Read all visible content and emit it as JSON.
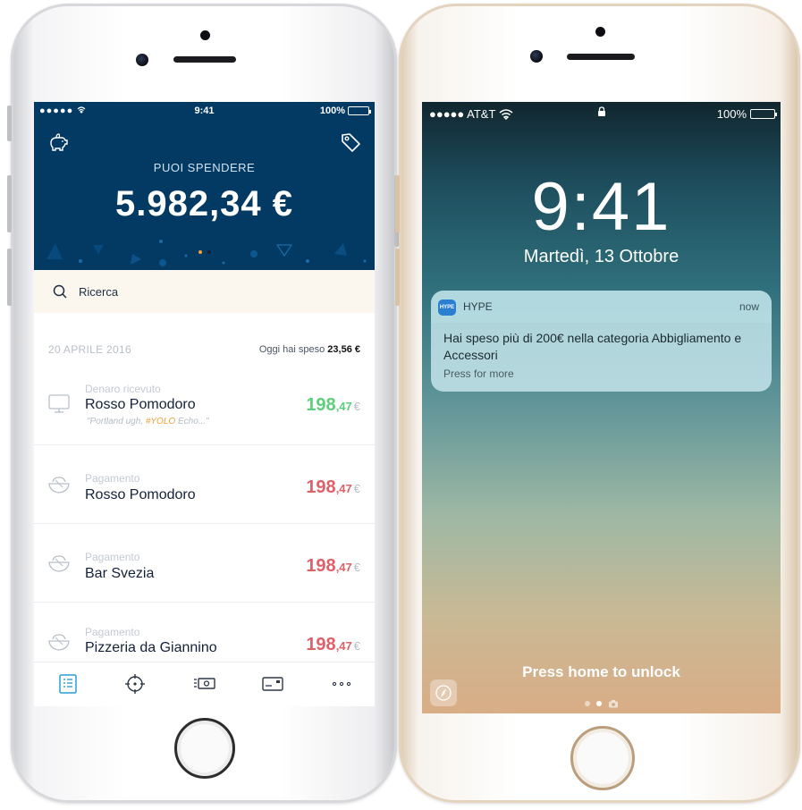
{
  "left_phone": {
    "status": {
      "signal": "●●●●●",
      "time": "9:41",
      "battery": "100%"
    },
    "header": {
      "label": "PUOI SPENDERE",
      "amount": "5.982,34 €"
    },
    "search": {
      "label": "Ricerca"
    },
    "date_row": {
      "date": "20 APRILE 2016",
      "spent_prefix": "Oggi hai speso",
      "spent_value": "23,56 €"
    },
    "transactions": [
      {
        "type": "Denaro ricevuto",
        "name": "Rosso Pomodoro",
        "note_prefix": "\"Portland ugh, ",
        "note_tag": "#YOLO",
        "note_suffix": " Echo...\"",
        "amount_int": "198",
        "amount_dec": ",47",
        "currency": "€",
        "direction": "in"
      },
      {
        "type": "Pagamento",
        "name": "Rosso Pomodoro",
        "amount_int": "198",
        "amount_dec": ",47",
        "currency": "€",
        "direction": "out"
      },
      {
        "type": "Pagamento",
        "name": "Bar Svezia",
        "amount_int": "198",
        "amount_dec": ",47",
        "currency": "€",
        "direction": "out"
      },
      {
        "type": "Pagamento",
        "name": "Pizzeria da Giannino",
        "amount_int": "198",
        "amount_dec": ",47",
        "currency": "€",
        "direction": "out"
      }
    ],
    "tabs": [
      "list-icon",
      "target-icon",
      "cash-icon",
      "card-icon",
      "more-icon"
    ],
    "colors": {
      "header": "#033a64",
      "income": "#5ccf7b",
      "expense": "#e0606a",
      "accent": "#2a9fd6"
    }
  },
  "right_phone": {
    "status": {
      "carrier": "●●●●● AT&T",
      "battery": "100%"
    },
    "time": "9:41",
    "date": "Martedì, 13 Ottobre",
    "notification": {
      "app_icon_text": "HYPE",
      "app": "HYPE",
      "time": "now",
      "body": "Hai speso più di 200€ nella categoria Abbigliamento e Accessori",
      "more": "Press for more"
    },
    "unlock_hint": "Press home to unlock"
  }
}
